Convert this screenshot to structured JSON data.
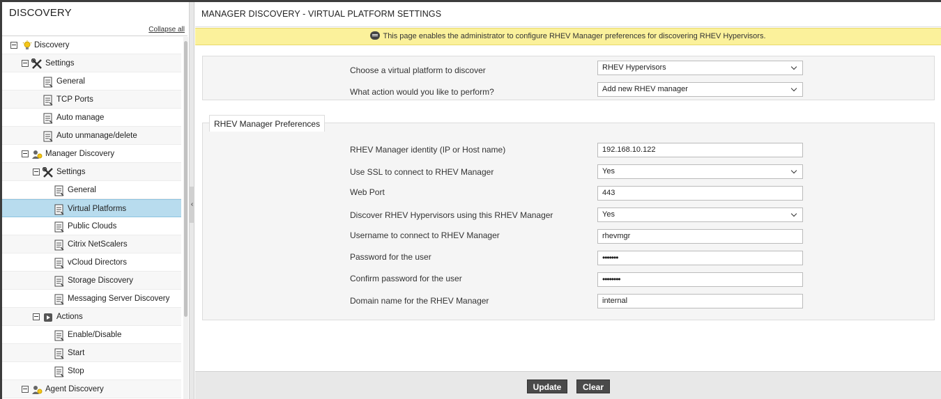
{
  "sidebar": {
    "title": "DISCOVERY",
    "collapse_all": "Collapse all",
    "items": [
      {
        "label": "Discovery"
      },
      {
        "label": "Settings"
      },
      {
        "label": "General"
      },
      {
        "label": "TCP Ports"
      },
      {
        "label": "Auto manage"
      },
      {
        "label": "Auto unmanage/delete"
      },
      {
        "label": "Manager Discovery"
      },
      {
        "label": "Settings"
      },
      {
        "label": "General"
      },
      {
        "label": "Virtual Platforms"
      },
      {
        "label": "Public Clouds"
      },
      {
        "label": "Citrix NetScalers"
      },
      {
        "label": "vCloud Directors"
      },
      {
        "label": "Storage Discovery"
      },
      {
        "label": "Messaging Server Discovery"
      },
      {
        "label": "Actions"
      },
      {
        "label": "Enable/Disable"
      },
      {
        "label": "Start"
      },
      {
        "label": "Stop"
      },
      {
        "label": "Agent Discovery"
      }
    ]
  },
  "main": {
    "title": "MANAGER DISCOVERY - VIRTUAL PLATFORM SETTINGS",
    "info": "This page enables the administrator to configure RHEV Manager preferences for discovering RHEV Hypervisors.",
    "platform": {
      "label": "Choose a virtual platform to discover",
      "value": "RHEV Hypervisors"
    },
    "action": {
      "label": "What action would you like to perform?",
      "value": "Add new RHEV manager"
    },
    "prefs": {
      "legend": "RHEV Manager Preferences",
      "identity_label": "RHEV Manager identity (IP or Host name)",
      "identity_value": "192.168.10.122",
      "ssl_label": "Use SSL to connect to RHEV Manager",
      "ssl_value": "Yes",
      "port_label": "Web Port",
      "port_value": "443",
      "discover_label": "Discover RHEV Hypervisors using this RHEV Manager",
      "discover_value": "Yes",
      "username_label": "Username to connect to RHEV Manager",
      "username_value": "rhevmgr",
      "password_label": "Password for the user",
      "password_value": "•••••••",
      "confirm_label": "Confirm password for the user",
      "confirm_value": "••••••••",
      "domain_label": "Domain name for the RHEV Manager",
      "domain_value": "internal"
    },
    "buttons": {
      "update": "Update",
      "clear": "Clear"
    }
  }
}
